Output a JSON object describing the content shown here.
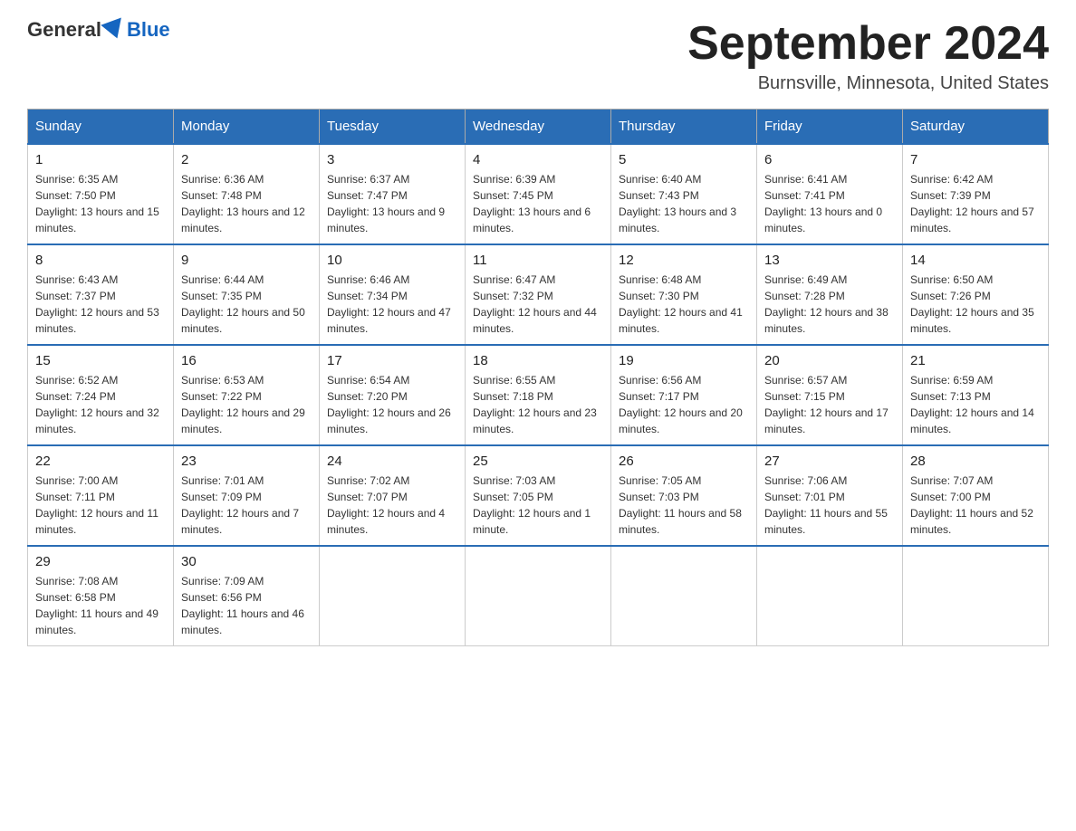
{
  "header": {
    "logo_general": "General",
    "logo_blue": "Blue",
    "title": "September 2024",
    "location": "Burnsville, Minnesota, United States"
  },
  "days_of_week": [
    "Sunday",
    "Monday",
    "Tuesday",
    "Wednesday",
    "Thursday",
    "Friday",
    "Saturday"
  ],
  "weeks": [
    [
      {
        "day": "1",
        "sunrise": "6:35 AM",
        "sunset": "7:50 PM",
        "daylight": "13 hours and 15 minutes."
      },
      {
        "day": "2",
        "sunrise": "6:36 AM",
        "sunset": "7:48 PM",
        "daylight": "13 hours and 12 minutes."
      },
      {
        "day": "3",
        "sunrise": "6:37 AM",
        "sunset": "7:47 PM",
        "daylight": "13 hours and 9 minutes."
      },
      {
        "day": "4",
        "sunrise": "6:39 AM",
        "sunset": "7:45 PM",
        "daylight": "13 hours and 6 minutes."
      },
      {
        "day": "5",
        "sunrise": "6:40 AM",
        "sunset": "7:43 PM",
        "daylight": "13 hours and 3 minutes."
      },
      {
        "day": "6",
        "sunrise": "6:41 AM",
        "sunset": "7:41 PM",
        "daylight": "13 hours and 0 minutes."
      },
      {
        "day": "7",
        "sunrise": "6:42 AM",
        "sunset": "7:39 PM",
        "daylight": "12 hours and 57 minutes."
      }
    ],
    [
      {
        "day": "8",
        "sunrise": "6:43 AM",
        "sunset": "7:37 PM",
        "daylight": "12 hours and 53 minutes."
      },
      {
        "day": "9",
        "sunrise": "6:44 AM",
        "sunset": "7:35 PM",
        "daylight": "12 hours and 50 minutes."
      },
      {
        "day": "10",
        "sunrise": "6:46 AM",
        "sunset": "7:34 PM",
        "daylight": "12 hours and 47 minutes."
      },
      {
        "day": "11",
        "sunrise": "6:47 AM",
        "sunset": "7:32 PM",
        "daylight": "12 hours and 44 minutes."
      },
      {
        "day": "12",
        "sunrise": "6:48 AM",
        "sunset": "7:30 PM",
        "daylight": "12 hours and 41 minutes."
      },
      {
        "day": "13",
        "sunrise": "6:49 AM",
        "sunset": "7:28 PM",
        "daylight": "12 hours and 38 minutes."
      },
      {
        "day": "14",
        "sunrise": "6:50 AM",
        "sunset": "7:26 PM",
        "daylight": "12 hours and 35 minutes."
      }
    ],
    [
      {
        "day": "15",
        "sunrise": "6:52 AM",
        "sunset": "7:24 PM",
        "daylight": "12 hours and 32 minutes."
      },
      {
        "day": "16",
        "sunrise": "6:53 AM",
        "sunset": "7:22 PM",
        "daylight": "12 hours and 29 minutes."
      },
      {
        "day": "17",
        "sunrise": "6:54 AM",
        "sunset": "7:20 PM",
        "daylight": "12 hours and 26 minutes."
      },
      {
        "day": "18",
        "sunrise": "6:55 AM",
        "sunset": "7:18 PM",
        "daylight": "12 hours and 23 minutes."
      },
      {
        "day": "19",
        "sunrise": "6:56 AM",
        "sunset": "7:17 PM",
        "daylight": "12 hours and 20 minutes."
      },
      {
        "day": "20",
        "sunrise": "6:57 AM",
        "sunset": "7:15 PM",
        "daylight": "12 hours and 17 minutes."
      },
      {
        "day": "21",
        "sunrise": "6:59 AM",
        "sunset": "7:13 PM",
        "daylight": "12 hours and 14 minutes."
      }
    ],
    [
      {
        "day": "22",
        "sunrise": "7:00 AM",
        "sunset": "7:11 PM",
        "daylight": "12 hours and 11 minutes."
      },
      {
        "day": "23",
        "sunrise": "7:01 AM",
        "sunset": "7:09 PM",
        "daylight": "12 hours and 7 minutes."
      },
      {
        "day": "24",
        "sunrise": "7:02 AM",
        "sunset": "7:07 PM",
        "daylight": "12 hours and 4 minutes."
      },
      {
        "day": "25",
        "sunrise": "7:03 AM",
        "sunset": "7:05 PM",
        "daylight": "12 hours and 1 minute."
      },
      {
        "day": "26",
        "sunrise": "7:05 AM",
        "sunset": "7:03 PM",
        "daylight": "11 hours and 58 minutes."
      },
      {
        "day": "27",
        "sunrise": "7:06 AM",
        "sunset": "7:01 PM",
        "daylight": "11 hours and 55 minutes."
      },
      {
        "day": "28",
        "sunrise": "7:07 AM",
        "sunset": "7:00 PM",
        "daylight": "11 hours and 52 minutes."
      }
    ],
    [
      {
        "day": "29",
        "sunrise": "7:08 AM",
        "sunset": "6:58 PM",
        "daylight": "11 hours and 49 minutes."
      },
      {
        "day": "30",
        "sunrise": "7:09 AM",
        "sunset": "6:56 PM",
        "daylight": "11 hours and 46 minutes."
      },
      null,
      null,
      null,
      null,
      null
    ]
  ],
  "labels": {
    "sunrise_label": "Sunrise: ",
    "sunset_label": "Sunset: ",
    "daylight_label": "Daylight: "
  }
}
